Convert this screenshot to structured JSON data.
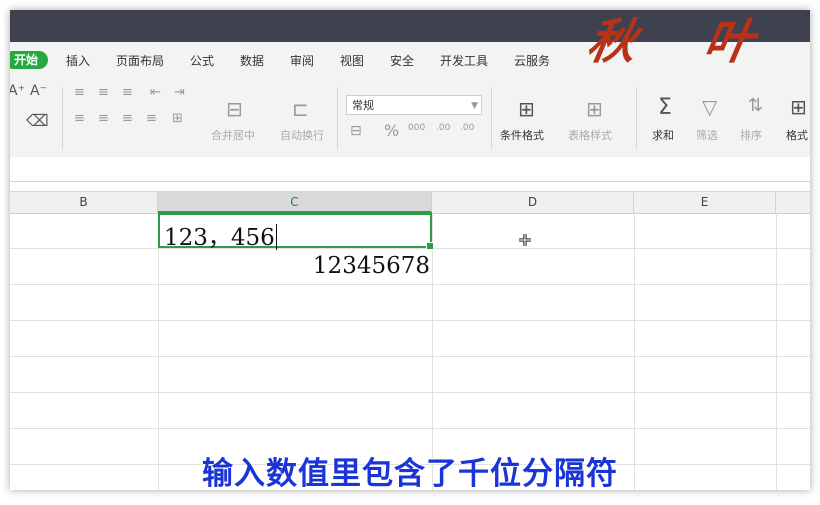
{
  "menu": {
    "tabs": [
      "开始",
      "插入",
      "页面布局",
      "公式",
      "数据",
      "审阅",
      "视图",
      "安全",
      "开发工具",
      "云服务"
    ]
  },
  "logo_text": "秋 叶 ",
  "ribbon": {
    "font_grow": "A⁺",
    "font_shrink": "A⁻",
    "merge_label": "合并居中",
    "wrap_label": "自动换行",
    "number_format": "常规",
    "percent": "%",
    "thousands": "000",
    "dec_inc": ".00",
    "cond_format_label": "条件格式",
    "table_style_label": "表格样式",
    "sum_label": "求和",
    "filter_label": "筛选",
    "sort_label": "排序",
    "format_label": "格式"
  },
  "columns": [
    {
      "label": "B",
      "selected": false
    },
    {
      "label": "C",
      "selected": true
    },
    {
      "label": "D",
      "selected": false
    },
    {
      "label": "E",
      "selected": false
    }
  ],
  "cells": {
    "editing_text": "123，456",
    "value_below": "12345678"
  },
  "subtitle": "输入数值里包含了千位分隔符",
  "colors": {
    "accent": "#2f9b48",
    "subtitle": "#1b34d6",
    "titlebar": "#3d4150"
  }
}
